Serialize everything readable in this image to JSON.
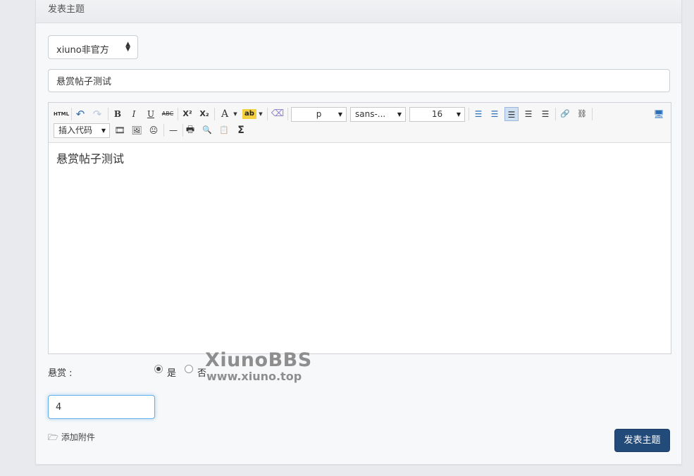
{
  "header": {
    "title": "发表主题"
  },
  "forum_select": {
    "value": "xiuno非官方",
    "caret": "⬍"
  },
  "title_field": {
    "value": "悬赏帖子测试"
  },
  "editor": {
    "toolbar": {
      "html": "HTML",
      "undo": "↶",
      "redo": "↷",
      "bold": "B",
      "italic": "I",
      "underline": "U",
      "strike": "ABC",
      "superscript": "X²",
      "subscript": "X₂",
      "font_color": "A",
      "highlight": "ab",
      "eraser": "⌫",
      "paragraph": "p",
      "font_family": "sans-...",
      "font_size": "16",
      "ordered_list": "☰",
      "unordered_list": "☰",
      "align_left": "☰",
      "align_center": "☰",
      "align_right": "☰",
      "link": "🔗",
      "unlink": "⛓",
      "fullscreen": "🖥",
      "insert_code": "插入代码",
      "video": "🎞",
      "image": "🖼",
      "emoji": "😐",
      "hr": "—",
      "print": "🖶",
      "preview": "🔍",
      "paste": "📋",
      "formula": "Σ"
    },
    "content": "悬赏帖子测试"
  },
  "reward": {
    "label": "悬赏 :",
    "yes": "是",
    "no": "否",
    "selected": "yes",
    "amount": "4"
  },
  "watermark": {
    "title": "XiunoBBS",
    "url": "www.xiuno.top"
  },
  "attach": {
    "label": "添加附件"
  },
  "submit": {
    "label": "发表主题"
  }
}
